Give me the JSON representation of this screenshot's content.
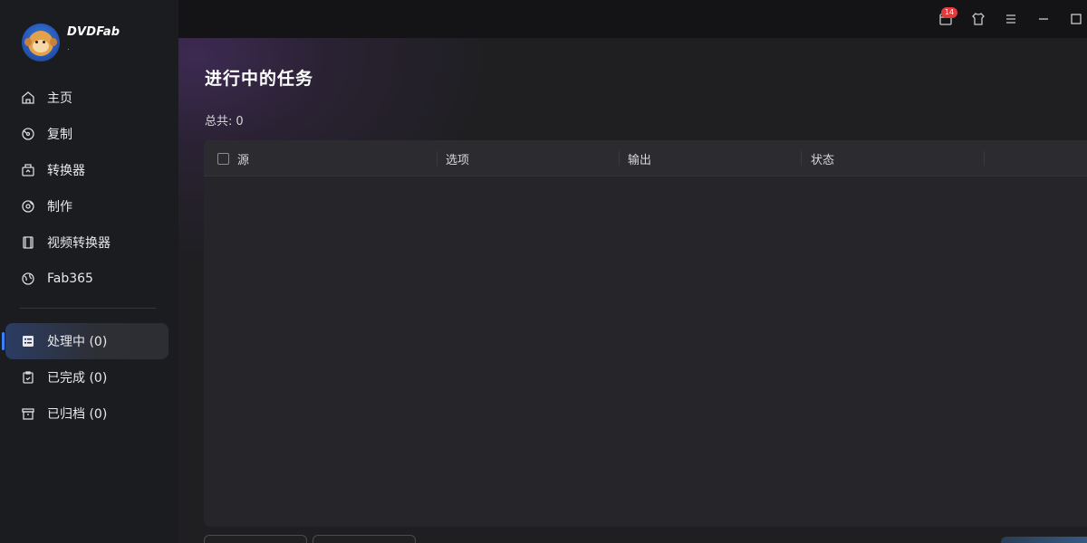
{
  "app": {
    "logo_text": "DVDFab",
    "logo_subtext": "."
  },
  "sidebar": {
    "items": [
      {
        "label": "主页",
        "icon": "home-icon"
      },
      {
        "label": "复制",
        "icon": "copy-disc-icon"
      },
      {
        "label": "转换器",
        "icon": "converter-icon"
      },
      {
        "label": "制作",
        "icon": "creator-disc-icon"
      },
      {
        "label": "视频转换器",
        "icon": "film-icon"
      },
      {
        "label": "Fab365",
        "icon": "globe-icon"
      }
    ],
    "tasks": [
      {
        "label": "处理中 (0)",
        "icon": "processing-list-icon",
        "active": true
      },
      {
        "label": "已完成 (0)",
        "icon": "clipboard-check-icon",
        "active": false
      },
      {
        "label": "已归档 (0)",
        "icon": "archive-box-icon",
        "active": false
      }
    ]
  },
  "topbar": {
    "notification_count": "14",
    "icons": [
      "calendar-notification-icon",
      "shirt-skin-icon",
      "menu-icon",
      "minimize-icon",
      "maximize-icon"
    ]
  },
  "main": {
    "title": "进行中的任务",
    "total_label": "总共:",
    "total_value": "0",
    "table": {
      "columns": [
        "源",
        "选项",
        "输出",
        "状态"
      ]
    }
  },
  "colors": {
    "accent": "#3b82f6",
    "badge": "#e33b3b",
    "background": "#1b1c1f"
  }
}
